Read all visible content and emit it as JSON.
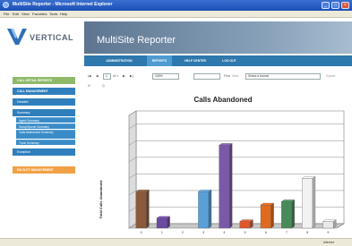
{
  "window": {
    "title": "MultiSite Reporter - Microsoft Internet Explorer",
    "menu": [
      "File",
      "Edit",
      "View",
      "Favorites",
      "Tools",
      "Help"
    ]
  },
  "brand": {
    "name": "VERTICAL",
    "product": "MultiSite Reporter"
  },
  "tabs": [
    {
      "label": "ADMINISTRATION",
      "active": false
    },
    {
      "label": "REPORTS",
      "active": true
    },
    {
      "label": "HELP CENTER",
      "active": false
    },
    {
      "label": "LOG OUT",
      "active": false
    }
  ],
  "sidebar": {
    "call_detail": "CALL DETAIL REPORTS",
    "call_management": "CALL MANAGEMENT",
    "detailed": "Detailed",
    "summary": "Summary",
    "summary_items": [
      "Agent Summary",
      "Group/Queue Summary",
      "Calls Abandoned Summary",
      "Trunk Summary"
    ],
    "exception": "Exception",
    "facility": "FACILITY MANAGEMENT"
  },
  "toolbar": {
    "page_current": "1",
    "page_of": "of 1",
    "zoom": "100%",
    "find_label": "Find",
    "next_label": "Next",
    "format_placeholder": "Select a format",
    "export_label": "Export"
  },
  "status": {
    "zone": "Internet"
  },
  "colors": {
    "accent_blue": "#2f7fbd",
    "sidebar_green": "#8fba6a",
    "sidebar_orange": "#f0a146"
  },
  "chart_data": {
    "type": "bar",
    "title": "Calls Abandoned",
    "ylabel": "Total Calls Abandoned",
    "categories": [
      "0",
      "1",
      "2",
      "3",
      "4",
      "5",
      "6",
      "7",
      "8",
      "9"
    ],
    "values": [
      11,
      3,
      0,
      11,
      25,
      2,
      7,
      8,
      15,
      2
    ],
    "colors": [
      "#8a5a3a",
      "#6b4aa0",
      "#c0c0c0",
      "#5aa0d8",
      "#7a5aa8",
      "#e0552a",
      "#e06a20",
      "#4a8a5a",
      "#f2f2f2",
      "#eaeaea"
    ],
    "ylim": [
      0,
      34
    ],
    "grid": true
  }
}
